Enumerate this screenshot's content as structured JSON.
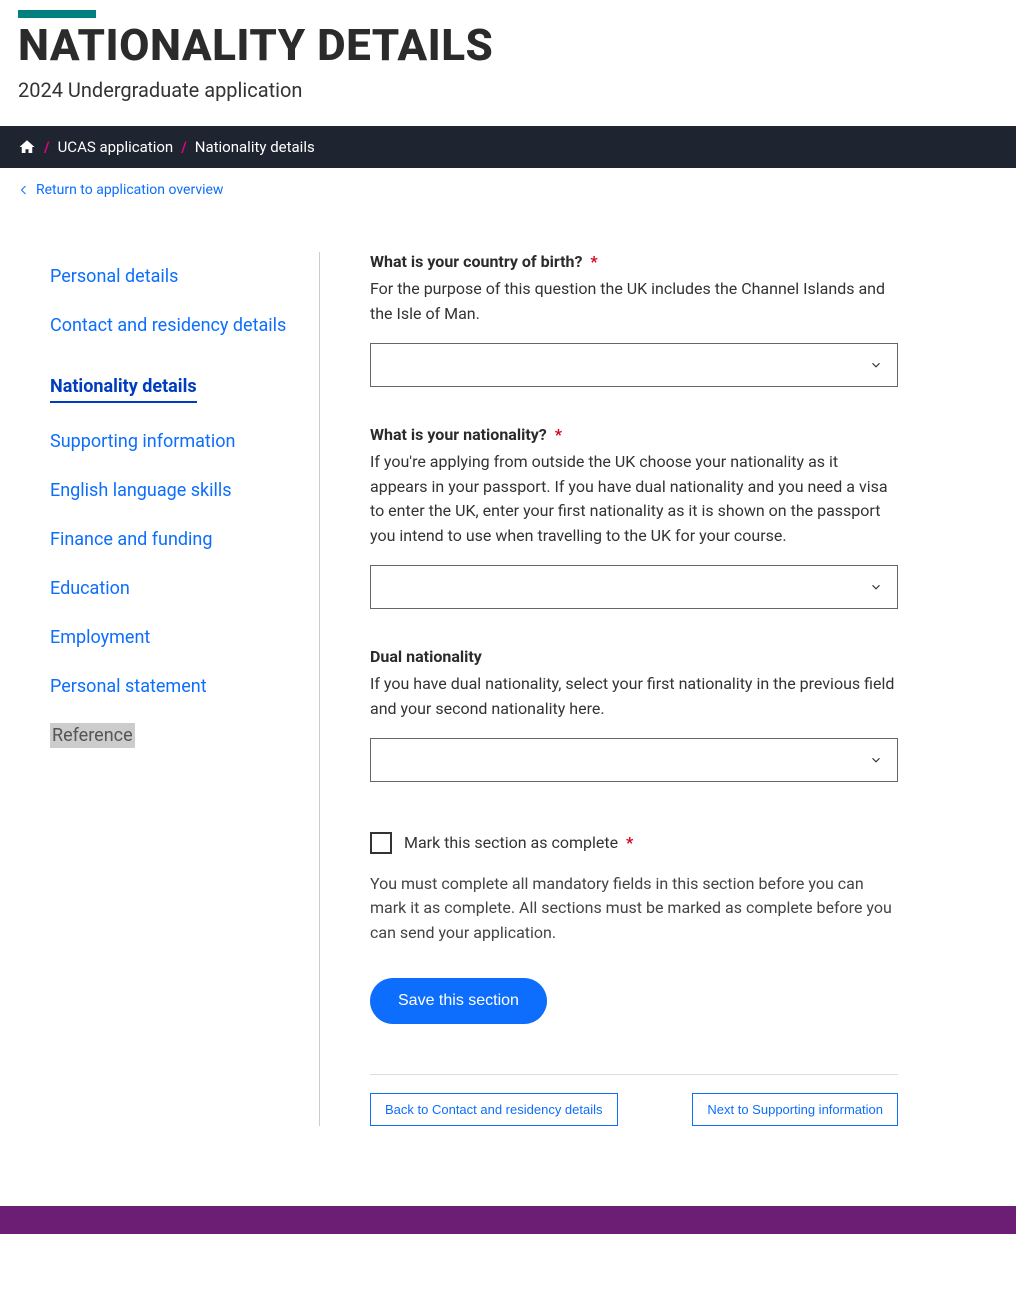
{
  "header": {
    "title": "NATIONALITY DETAILS",
    "subtitle": "2024 Undergraduate application"
  },
  "breadcrumb": {
    "items": [
      {
        "label": "UCAS application"
      },
      {
        "label": "Nationality details"
      }
    ]
  },
  "return_link": "Return to application overview",
  "sidebar": {
    "items": [
      {
        "label": "Personal details",
        "state": "link"
      },
      {
        "label": "Contact and residency details",
        "state": "link"
      },
      {
        "label": "Nationality details",
        "state": "active"
      },
      {
        "label": "Supporting information",
        "state": "link"
      },
      {
        "label": "English language skills",
        "state": "link"
      },
      {
        "label": "Finance and funding",
        "state": "link"
      },
      {
        "label": "Education",
        "state": "link"
      },
      {
        "label": "Employment",
        "state": "link"
      },
      {
        "label": "Personal statement",
        "state": "link"
      },
      {
        "label": "Reference",
        "state": "disabled"
      }
    ]
  },
  "form": {
    "country_of_birth": {
      "label": "What is your country of birth?",
      "required": true,
      "help": "For the purpose of this question the UK includes the Channel Islands and the Isle of Man.",
      "value": ""
    },
    "nationality": {
      "label": "What is your nationality?",
      "required": true,
      "help": "If you're applying from outside the UK choose your nationality as it appears in your passport. If you have dual nationality and you need a visa to enter the UK, enter your first nationality as it is shown on the passport you intend to use when travelling to the UK for your course.",
      "value": ""
    },
    "dual_nationality": {
      "label": "Dual nationality",
      "required": false,
      "help": "If you have dual nationality, select your first nationality in the previous field and your second nationality here.",
      "value": ""
    },
    "complete": {
      "checkbox_label": "Mark this section as complete",
      "required": true,
      "help": "You must complete all mandatory fields in this section before you can mark it as complete. All sections must be marked as complete before you can send your application."
    },
    "save_button": "Save this section",
    "footer_nav": {
      "back": "Back to Contact and residency details",
      "next": "Next to Supporting information"
    }
  }
}
